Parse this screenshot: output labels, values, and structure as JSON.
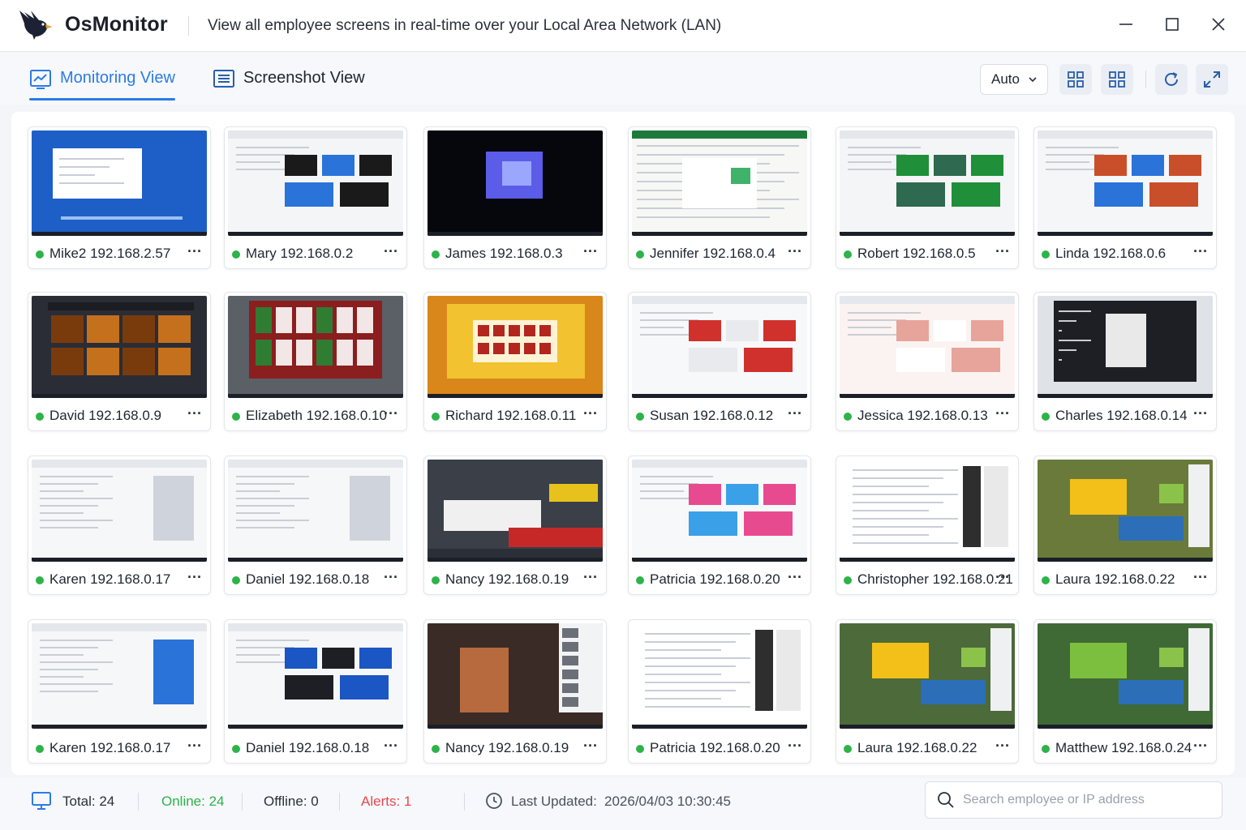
{
  "app": {
    "name": "OsMonitor",
    "subtitle": "View all employee screens in real-time over your Local Area Network (LAN)"
  },
  "toolbar": {
    "tabs": [
      {
        "label": "Monitoring View",
        "active": true
      },
      {
        "label": "Screenshot View",
        "active": false
      }
    ],
    "refresh_mode": "Auto",
    "accent_color": "#2c7be5"
  },
  "employees": [
    {
      "label": "Mike2 192.168.2.57",
      "online": true
    },
    {
      "label": "Mary 192.168.0.2",
      "online": true
    },
    {
      "label": "James 192.168.0.3",
      "online": true
    },
    {
      "label": "Jennifer 192.168.0.4",
      "online": true
    },
    {
      "label": "Robert 192.168.0.5",
      "online": true
    },
    {
      "label": "Linda 192.168.0.6",
      "online": true
    },
    {
      "label": "David 192.168.0.9",
      "online": true
    },
    {
      "label": "Elizabeth 192.168.0.10",
      "online": true
    },
    {
      "label": "Richard 192.168.0.11",
      "online": true
    },
    {
      "label": "Susan 192.168.0.12",
      "online": true
    },
    {
      "label": "Jessica 192.168.0.13",
      "online": true
    },
    {
      "label": "Charles 192.168.0.14",
      "online": true
    },
    {
      "label": "Karen 192.168.0.17",
      "online": true
    },
    {
      "label": "Daniel 192.168.0.18",
      "online": true
    },
    {
      "label": "Nancy 192.168.0.19",
      "online": true
    },
    {
      "label": "Patricia 192.168.0.20",
      "online": true
    },
    {
      "label": "Christopher 192.168.0.21",
      "online": true
    },
    {
      "label": "Laura 192.168.0.22",
      "online": true
    },
    {
      "label": "Karen 192.168.0.17",
      "online": true
    },
    {
      "label": "Daniel 192.168.0.18",
      "online": true
    },
    {
      "label": "Nancy 192.168.0.19",
      "online": true
    },
    {
      "label": "Patricia 192.168.0.20",
      "online": true
    },
    {
      "label": "Laura 192.168.0.22",
      "online": true
    },
    {
      "label": "Matthew 192.168.0.24",
      "online": true
    }
  ],
  "more_label": "···",
  "status": {
    "total": "Total: 24",
    "online": "Online: 24",
    "offline": "Offline: 0",
    "alerts": "Alerts: 1",
    "last_updated_label": "Last Updated:",
    "last_updated_value": "2026/04/03 10:30:45",
    "online_color": "#2db34a",
    "alert_color": "#e5484d"
  },
  "search": {
    "placeholder": "Search employee or IP address",
    "value": ""
  }
}
